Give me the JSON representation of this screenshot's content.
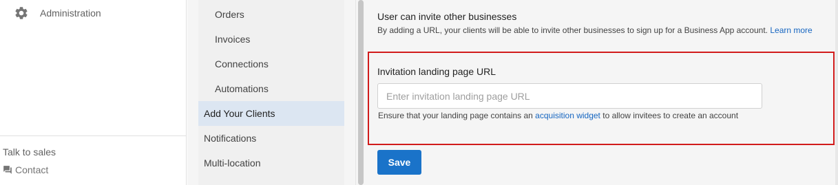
{
  "sidebar": {
    "admin_label": "Administration",
    "talk_to_sales": "Talk to sales",
    "contact": "Contact"
  },
  "settings_nav": {
    "items": [
      {
        "label": "Orders"
      },
      {
        "label": "Invoices"
      },
      {
        "label": "Connections"
      },
      {
        "label": "Automations"
      },
      {
        "label": "Add Your Clients"
      },
      {
        "label": "Notifications"
      },
      {
        "label": "Multi-location"
      }
    ],
    "active": "Add Your Clients"
  },
  "content": {
    "invite_title": "User can invite other businesses",
    "invite_desc": "By adding a URL, your clients will be able to invite other businesses to sign up for a Business App account.",
    "learn_more": "Learn more",
    "field_label": "Invitation landing page URL",
    "input_value": "",
    "input_placeholder": "Enter invitation landing page URL",
    "helper_prefix": "Ensure that your landing page contains an",
    "helper_link": "acquisition widget",
    "helper_suffix": "to allow invitees to create an account",
    "save_label": "Save"
  },
  "colors": {
    "accent": "#1a73c9",
    "link": "#1565c0",
    "highlight_border": "#d11a1a",
    "active_nav_bg": "#dce6f2"
  }
}
